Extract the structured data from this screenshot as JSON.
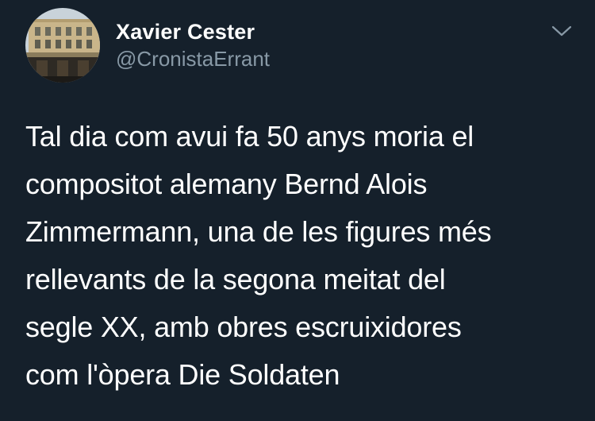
{
  "user": {
    "display_name": "Xavier Cester",
    "handle": "@CronistaErrant",
    "avatar_icon": "building-facade-photo"
  },
  "menu": {
    "icon": "chevron-down-icon"
  },
  "tweet": {
    "lines": [
      "Tal dia com avui fa 50 anys moria el",
      "compositot alemany Bernd Alois",
      "Zimmermann, una de les figures més",
      "rellevants de la segona meitat del",
      "segle XX, amb obres escruixidores",
      "com l'òpera Die Soldaten"
    ]
  },
  "colors": {
    "background": "#15202b",
    "primary_text": "#ffffff",
    "secondary_text": "#8899a6"
  }
}
